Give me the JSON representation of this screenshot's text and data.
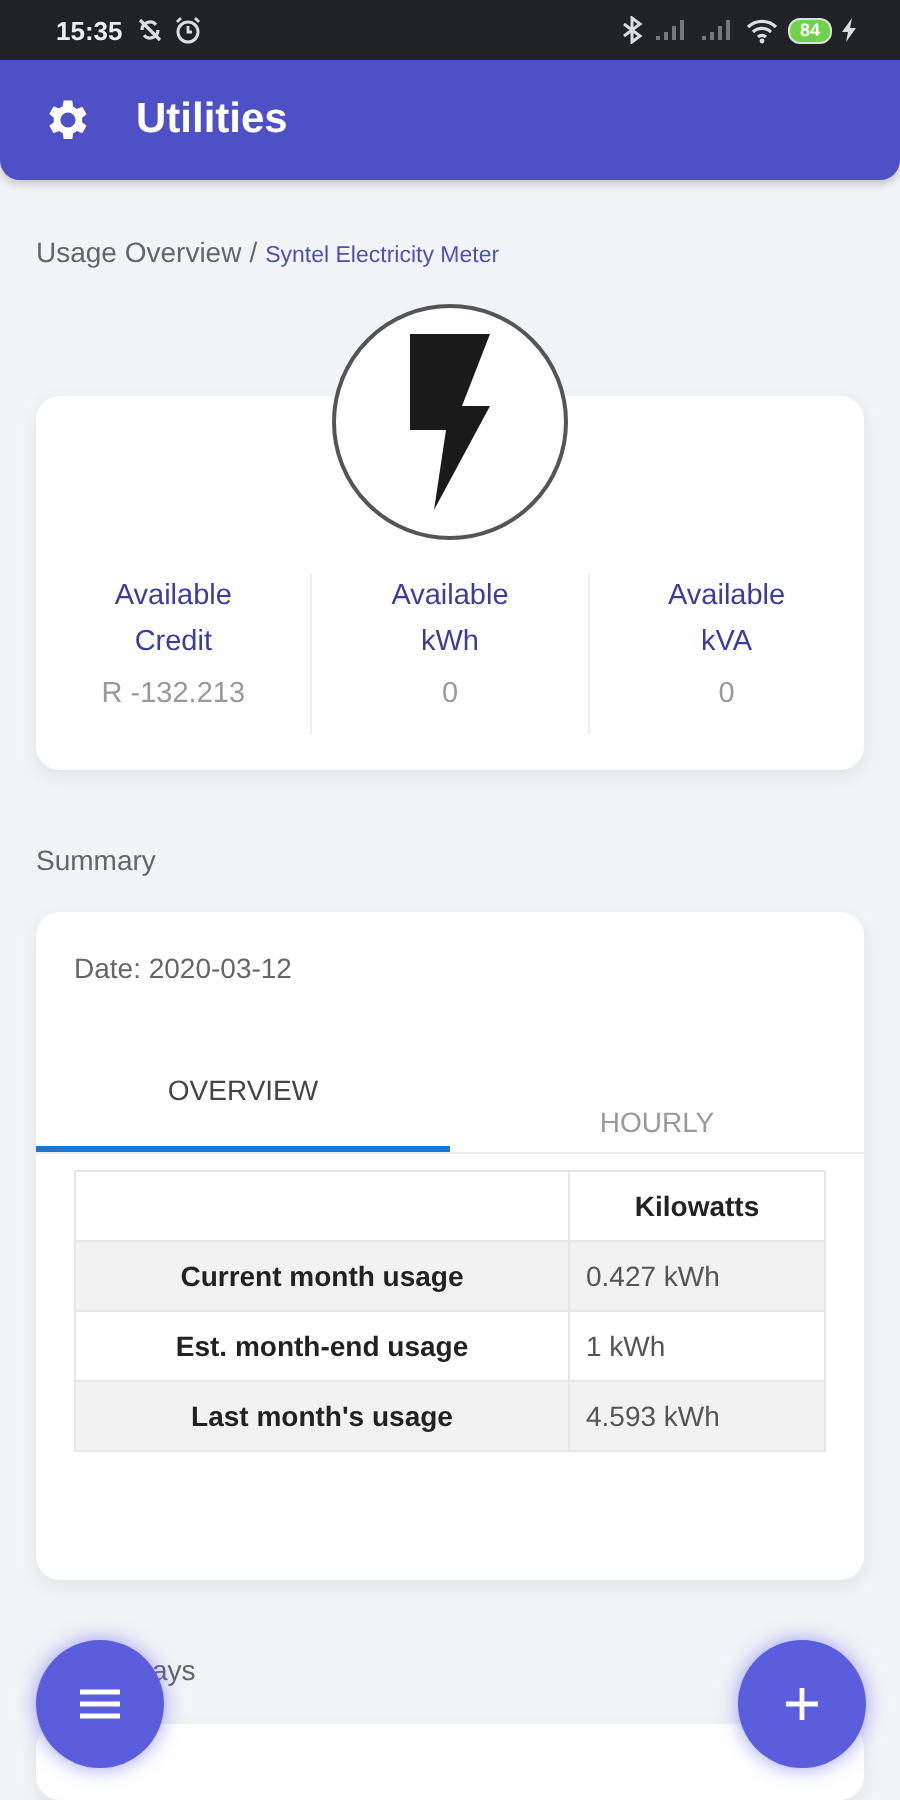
{
  "status_bar": {
    "time": "15:35",
    "battery": "84"
  },
  "app_bar": {
    "title": "Utilities"
  },
  "breadcrumb": {
    "section": "Usage Overview",
    "separator": "/",
    "meter": "Syntel Electricity Meter"
  },
  "meter_stats": [
    {
      "label": "Available Credit",
      "value": "R -132.213"
    },
    {
      "label": "Available kWh",
      "value": "0"
    },
    {
      "label": "Available kVA",
      "value": "0"
    }
  ],
  "summary": {
    "heading": "Summary",
    "date": "Date: 2020-03-12",
    "tabs": [
      {
        "label": "OVERVIEW",
        "selected": true
      },
      {
        "label": "HOURLY",
        "selected": false
      }
    ],
    "table": {
      "columns": [
        "Kilowatts"
      ],
      "rows": [
        {
          "label": "Current month usage",
          "value": "0.427 kWh"
        },
        {
          "label": "Est. month-end usage",
          "value": "1 kWh"
        },
        {
          "label": "Last month's usage",
          "value": "4.593 kWh"
        }
      ]
    }
  },
  "next_heading": "ays"
}
